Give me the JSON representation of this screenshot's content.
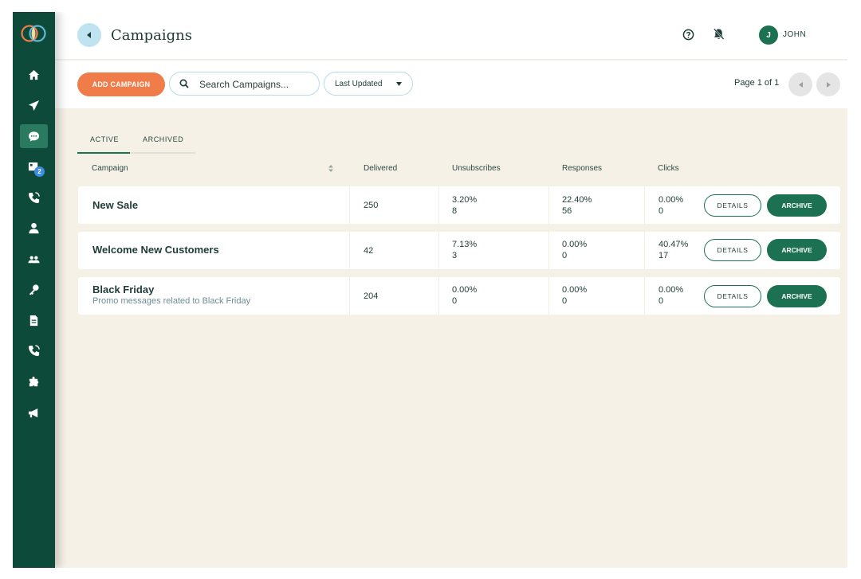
{
  "header": {
    "title": "Campaigns",
    "user_initial": "J",
    "user_name": "JOHN"
  },
  "sidebar": {
    "items": [
      {
        "icon": "home-icon"
      },
      {
        "icon": "send-icon"
      },
      {
        "icon": "chat-icon",
        "active": true
      },
      {
        "icon": "inbox-icon",
        "badge": "2"
      },
      {
        "icon": "phone-icon"
      },
      {
        "icon": "user-icon"
      },
      {
        "icon": "group-icon"
      },
      {
        "icon": "key-icon"
      },
      {
        "icon": "document-icon"
      },
      {
        "icon": "phone-call-icon"
      },
      {
        "icon": "puzzle-icon"
      },
      {
        "icon": "megaphone-icon"
      }
    ]
  },
  "toolbar": {
    "add_label": "ADD CAMPAIGN",
    "search_placeholder": "Search Campaigns...",
    "sort_label": "Last Updated",
    "pagination": "Page 1 of 1"
  },
  "tabs": [
    {
      "label": "ACTIVE",
      "active": true
    },
    {
      "label": "ARCHIVED",
      "active": false
    }
  ],
  "table": {
    "columns": [
      "Campaign",
      "Delivered",
      "Unsubscribes",
      "Responses",
      "Clicks"
    ],
    "rows": [
      {
        "name": "New Sale",
        "description": "",
        "delivered": "250",
        "unsub_pct": "3.20%",
        "unsub_count": "8",
        "resp_pct": "22.40%",
        "resp_count": "56",
        "clicks_pct": "0.00%",
        "clicks_count": "0"
      },
      {
        "name": "Welcome New Customers",
        "description": "",
        "delivered": "42",
        "unsub_pct": "7.13%",
        "unsub_count": "3",
        "resp_pct": "0.00%",
        "resp_count": "0",
        "clicks_pct": "40.47%",
        "clicks_count": "17"
      },
      {
        "name": "Black Friday",
        "description": "Promo messages related to Black Friday",
        "delivered": "204",
        "unsub_pct": "0.00%",
        "unsub_count": "0",
        "resp_pct": "0.00%",
        "resp_count": "0",
        "clicks_pct": "0.00%",
        "clicks_count": "0"
      }
    ],
    "details_label": "DETAILS",
    "archive_label": "ARCHIVE"
  },
  "colors": {
    "sidebar": "#0d4a3a",
    "primary": "#1c7152",
    "accent": "#ef7c49",
    "background": "#f6f1e7"
  }
}
